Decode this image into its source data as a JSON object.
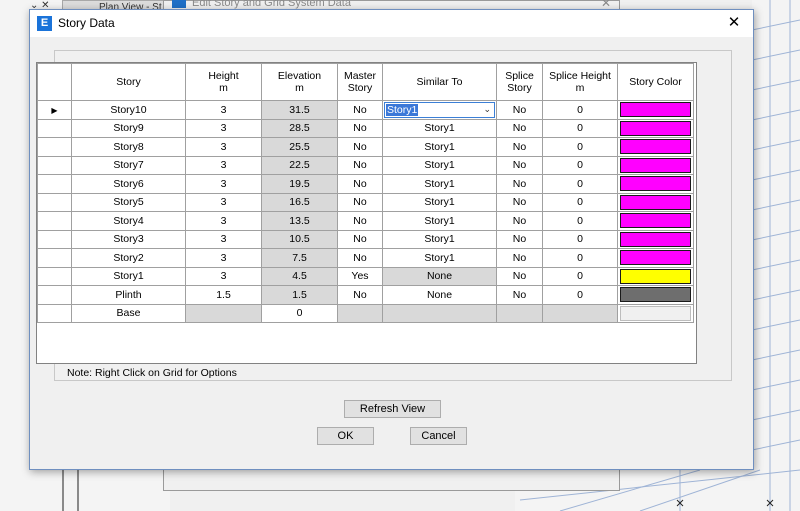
{
  "background": {
    "plan_view_tab": "Plan View - St",
    "edit_dialog_title": "Edit Story and Grid System Data",
    "edit_dialog_close": "✕"
  },
  "dialog": {
    "title": "Story Data",
    "app_icon": "E",
    "close_glyph": "✕"
  },
  "grid": {
    "columns": [
      {
        "line1": "Story",
        "line2": ""
      },
      {
        "line1": "Height",
        "line2": "m"
      },
      {
        "line1": "Elevation",
        "line2": "m"
      },
      {
        "line1": "Master",
        "line2": "Story"
      },
      {
        "line1": "Similar To",
        "line2": ""
      },
      {
        "line1": "Splice",
        "line2": "Story"
      },
      {
        "line1": "Splice Height",
        "line2": "m"
      },
      {
        "line1": "Story Color",
        "line2": ""
      }
    ],
    "current_row_marker": "▶",
    "combo_chevron": "⌄",
    "rows": [
      {
        "story": "Story10",
        "height": "3",
        "elevation": "31.5",
        "master": "No",
        "similar": "Story1",
        "splice": "No",
        "splice_height": "0",
        "color": "#ff00ff"
      },
      {
        "story": "Story9",
        "height": "3",
        "elevation": "28.5",
        "master": "No",
        "similar": "Story1",
        "splice": "No",
        "splice_height": "0",
        "color": "#ff00ff"
      },
      {
        "story": "Story8",
        "height": "3",
        "elevation": "25.5",
        "master": "No",
        "similar": "Story1",
        "splice": "No",
        "splice_height": "0",
        "color": "#ff00ff"
      },
      {
        "story": "Story7",
        "height": "3",
        "elevation": "22.5",
        "master": "No",
        "similar": "Story1",
        "splice": "No",
        "splice_height": "0",
        "color": "#ff00ff"
      },
      {
        "story": "Story6",
        "height": "3",
        "elevation": "19.5",
        "master": "No",
        "similar": "Story1",
        "splice": "No",
        "splice_height": "0",
        "color": "#ff00ff"
      },
      {
        "story": "Story5",
        "height": "3",
        "elevation": "16.5",
        "master": "No",
        "similar": "Story1",
        "splice": "No",
        "splice_height": "0",
        "color": "#ff00ff"
      },
      {
        "story": "Story4",
        "height": "3",
        "elevation": "13.5",
        "master": "No",
        "similar": "Story1",
        "splice": "No",
        "splice_height": "0",
        "color": "#ff00ff"
      },
      {
        "story": "Story3",
        "height": "3",
        "elevation": "10.5",
        "master": "No",
        "similar": "Story1",
        "splice": "No",
        "splice_height": "0",
        "color": "#ff00ff"
      },
      {
        "story": "Story2",
        "height": "3",
        "elevation": "7.5",
        "master": "No",
        "similar": "Story1",
        "splice": "No",
        "splice_height": "0",
        "color": "#ff00ff"
      },
      {
        "story": "Story1",
        "height": "3",
        "elevation": "4.5",
        "master": "Yes",
        "similar": "None",
        "splice": "No",
        "splice_height": "0",
        "color": "#ffff00"
      },
      {
        "story": "Plinth",
        "height": "1.5",
        "elevation": "1.5",
        "master": "No",
        "similar": "None",
        "splice": "No",
        "splice_height": "0",
        "color": "#6e6e6e"
      },
      {
        "story": "Base",
        "height": "",
        "elevation": "0",
        "master": "",
        "similar": "",
        "splice": "",
        "splice_height": "",
        "color": "#f0f0f0"
      }
    ]
  },
  "note": "Note:  Right Click on Grid for Options",
  "buttons": {
    "refresh": "Refresh View",
    "ok": "OK",
    "cancel": "Cancel"
  }
}
